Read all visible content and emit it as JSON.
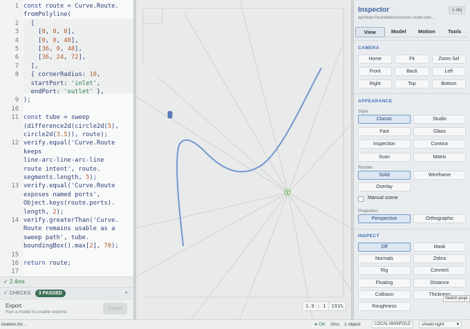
{
  "code": {
    "lines": [
      {
        "n": "1",
        "t": "const route = Curve.Route."
      },
      {
        "n": "",
        "t": "fromPolyline("
      },
      {
        "n": "2",
        "t": "  ["
      },
      {
        "n": "3",
        "t": "    [0, 0, 0],"
      },
      {
        "n": "4",
        "t": "    [0, 0, 48],"
      },
      {
        "n": "5",
        "t": "    [36, 0, 48],"
      },
      {
        "n": "6",
        "t": "    [36, 24, 72],"
      },
      {
        "n": "7",
        "t": "  ],"
      },
      {
        "n": "8",
        "t": "  { cornerRadius: 10,"
      },
      {
        "n": "",
        "t": "  startPort: 'inlet',"
      },
      {
        "n": "",
        "t": "  endPort: 'outlet' },"
      },
      {
        "n": "9",
        "t": ");"
      },
      {
        "n": "10",
        "t": ""
      },
      {
        "n": "11",
        "t": "const tube = sweep"
      },
      {
        "n": "",
        "t": "(difference2d(circle2d(5),"
      },
      {
        "n": "",
        "t": "circle2d(3.5)), route);"
      },
      {
        "n": "12",
        "t": "verify.equal('Curve.Route"
      },
      {
        "n": "",
        "t": "keeps"
      },
      {
        "n": "",
        "t": "line-arc-line-arc-line"
      },
      {
        "n": "",
        "t": "route intent', route."
      },
      {
        "n": "",
        "t": "segments.length, 5);"
      },
      {
        "n": "13",
        "t": "verify.equal('Curve.Route"
      },
      {
        "n": "",
        "t": "exposes named ports',"
      },
      {
        "n": "",
        "t": "Object.keys(route.ports)."
      },
      {
        "n": "",
        "t": "length, 2);"
      },
      {
        "n": "14",
        "t": "verify.greaterThan('Curve."
      },
      {
        "n": "",
        "t": "Route remains usable as a"
      },
      {
        "n": "",
        "t": "sweep path', tube."
      },
      {
        "n": "",
        "t": "boundingBox().max[2], 70);"
      },
      {
        "n": "15",
        "t": ""
      },
      {
        "n": "16",
        "t": "return route;"
      },
      {
        "n": "17",
        "t": ""
      }
    ]
  },
  "status": {
    "time": "✓ 2.4ms"
  },
  "checks": {
    "label": "✓ CHECKS",
    "badge": "3 PASSED",
    "arrow": "▸"
  },
  "export": {
    "title": "Export",
    "subtitle": "Run a model to enable exports",
    "button": "Export"
  },
  "viewport": {
    "zoom_ratio": "1.9 : 1",
    "zoom_pct": "191%",
    "axis_label": "Y"
  },
  "inspector": {
    "title": "Inspector",
    "subtitle": "api/lean-foundations/curve-route-can...",
    "count": "1 obj",
    "tabs": [
      "View",
      "Model",
      "Motion",
      "Tools"
    ],
    "active_tab": "View",
    "camera_heading": "CAMERA",
    "camera_buttons": [
      "Home",
      "Fit",
      "Zoom Sel",
      "Front",
      "Back",
      "Left",
      "Right",
      "Top",
      "Bottom"
    ],
    "appearance_heading": "APPEARANCE",
    "style_label": "Style",
    "style_buttons": [
      "Classic",
      "Studio",
      "Fast",
      "Glass",
      "Inspection",
      "Contour",
      "Scan",
      "Matrix"
    ],
    "style_selected": "Classic",
    "render_label": "Render",
    "render_buttons": [
      "Solid",
      "Wireframe",
      "Overlay"
    ],
    "render_selected": "Solid",
    "manual_scene": "Manual scene",
    "projection_label": "Projection",
    "projection_buttons": [
      "Perspective",
      "Orthographic"
    ],
    "projection_selected": "Perspective",
    "inspect_heading": "INSPECT",
    "inspect_buttons": [
      "Off",
      "Mask",
      "Normals",
      "Zebra",
      "Rig",
      "Connect",
      "Floating",
      "Distance",
      "Collision",
      "Thickness",
      "Roughness"
    ],
    "inspect_selected": "Off",
    "tooltip": "Switch proje"
  },
  "bottombar": {
    "left": "lization.for…",
    "ok": "● OK",
    "ms": "2ms",
    "objects": "1 object",
    "manifold": "LOCAL MANIFOLD",
    "theme": "shield-light",
    "theme_arrow": "▾"
  },
  "colors": {
    "accent": "#3e6fb6",
    "curve": "#7496cf",
    "ok": "#2f7a46"
  }
}
